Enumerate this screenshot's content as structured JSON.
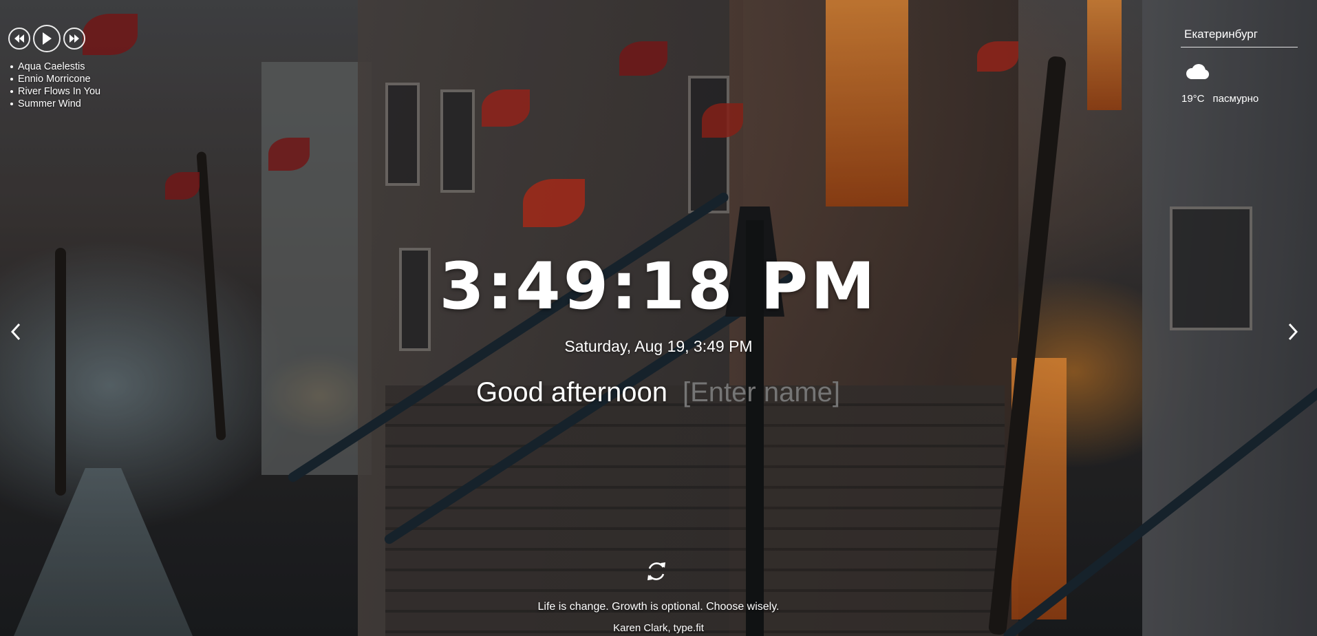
{
  "player": {
    "prev_icon": "rewind-icon",
    "play_icon": "play-icon",
    "next_icon": "fast-forward-icon",
    "playlist": [
      "Aqua Caelestis",
      "Ennio Morricone",
      "River Flows In You",
      "Summer Wind"
    ]
  },
  "weather": {
    "city": "Екатеринбург",
    "icon": "cloud-icon",
    "temperature": "19°C",
    "description": "пасмурно"
  },
  "slider": {
    "prev_icon": "chevron-left-icon",
    "next_icon": "chevron-right-icon"
  },
  "clock": {
    "time": "3:49:18 PM",
    "date": "Saturday, Aug 19, 3:49 PM"
  },
  "greeting": {
    "text": "Good afternoon",
    "name_placeholder": "[Enter name]"
  },
  "quote": {
    "refresh_icon": "refresh-icon",
    "text": "Life is change. Growth is optional. Choose wisely.",
    "author": "Karen Clark, type.fit"
  },
  "colors": {
    "text": "#ffffff",
    "placeholder": "rgba(255,255,255,0.55)"
  }
}
